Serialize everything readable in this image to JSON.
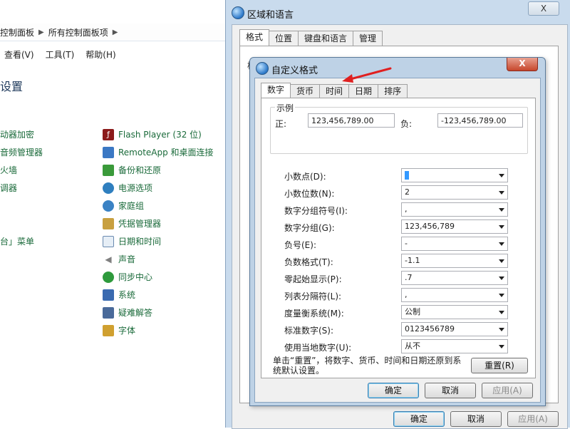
{
  "control_panel": {
    "address": [
      "控制面板",
      "所有控制面板项"
    ],
    "menu": [
      "查看(V)",
      "工具(T)",
      "帮助(H)"
    ],
    "title": "设置",
    "left_items": [
      "动器加密",
      "音频管理器",
      "火墙",
      "调器",
      "",
      "",
      "",
      "台」菜单"
    ],
    "right_items": [
      {
        "label": "Flash Player (32 位)",
        "icon": "flash-icon",
        "color": "#8b1a1a"
      },
      {
        "label": "RemoteApp 和桌面连接",
        "icon": "remoteapp-icon",
        "color": "#3b78c4"
      },
      {
        "label": "备份和还原",
        "icon": "backup-icon",
        "color": "#3a9a3a"
      },
      {
        "label": "电源选项",
        "icon": "power-icon",
        "color": "#2f7fbf"
      },
      {
        "label": "家庭组",
        "icon": "homegroup-icon",
        "color": "#3a82c4"
      },
      {
        "label": "凭据管理器",
        "icon": "credential-icon",
        "color": "#c8a040"
      },
      {
        "label": "日期和时间",
        "icon": "clock-icon",
        "color": "#6a8ab0"
      },
      {
        "label": "声音",
        "icon": "speaker-icon",
        "color": "#808080"
      },
      {
        "label": "同步中心",
        "icon": "sync-icon",
        "color": "#2e9a3c"
      },
      {
        "label": "系统",
        "icon": "system-icon",
        "color": "#3a6ab0"
      },
      {
        "label": "疑难解答",
        "icon": "troubleshoot-icon",
        "color": "#4a6a9a"
      },
      {
        "label": "字体",
        "icon": "fonts-icon",
        "color": "#d0a030"
      }
    ]
  },
  "region_dialog": {
    "title": "区域和语言",
    "close": "X",
    "tabs": [
      "格式",
      "位置",
      "键盘和语言",
      "管理"
    ],
    "partial_label": "格",
    "ok": "确定",
    "cancel": "取消",
    "apply": "应用(A)"
  },
  "custom_format": {
    "title": "自定义格式",
    "close": "X",
    "tabs": [
      "数字",
      "货币",
      "时间",
      "日期",
      "排序"
    ],
    "sample": {
      "legend": "示例",
      "positive_label": "正:",
      "positive_value": "123,456,789.00",
      "negative_label": "负:",
      "negative_value": "-123,456,789.00"
    },
    "fields": [
      {
        "label": "小数点(D):",
        "value": "."
      },
      {
        "label": "小数位数(N):",
        "value": "2"
      },
      {
        "label": "数字分组符号(I):",
        "value": ","
      },
      {
        "label": "数字分组(G):",
        "value": "123,456,789"
      },
      {
        "label": "负号(E):",
        "value": "-"
      },
      {
        "label": "负数格式(T):",
        "value": "-1.1"
      },
      {
        "label": "零起始显示(P):",
        "value": ".7"
      },
      {
        "label": "列表分隔符(L):",
        "value": ","
      },
      {
        "label": "度量衡系统(M):",
        "value": "公制"
      },
      {
        "label": "标准数字(S):",
        "value": "0123456789"
      },
      {
        "label": "使用当地数字(U):",
        "value": "从不"
      }
    ],
    "reset_text": "单击“重置”，将数字、货币、时间和日期还原到系统默认设置。",
    "reset_button": "重置(R)",
    "ok": "确定",
    "cancel": "取消",
    "apply": "应用(A)"
  }
}
